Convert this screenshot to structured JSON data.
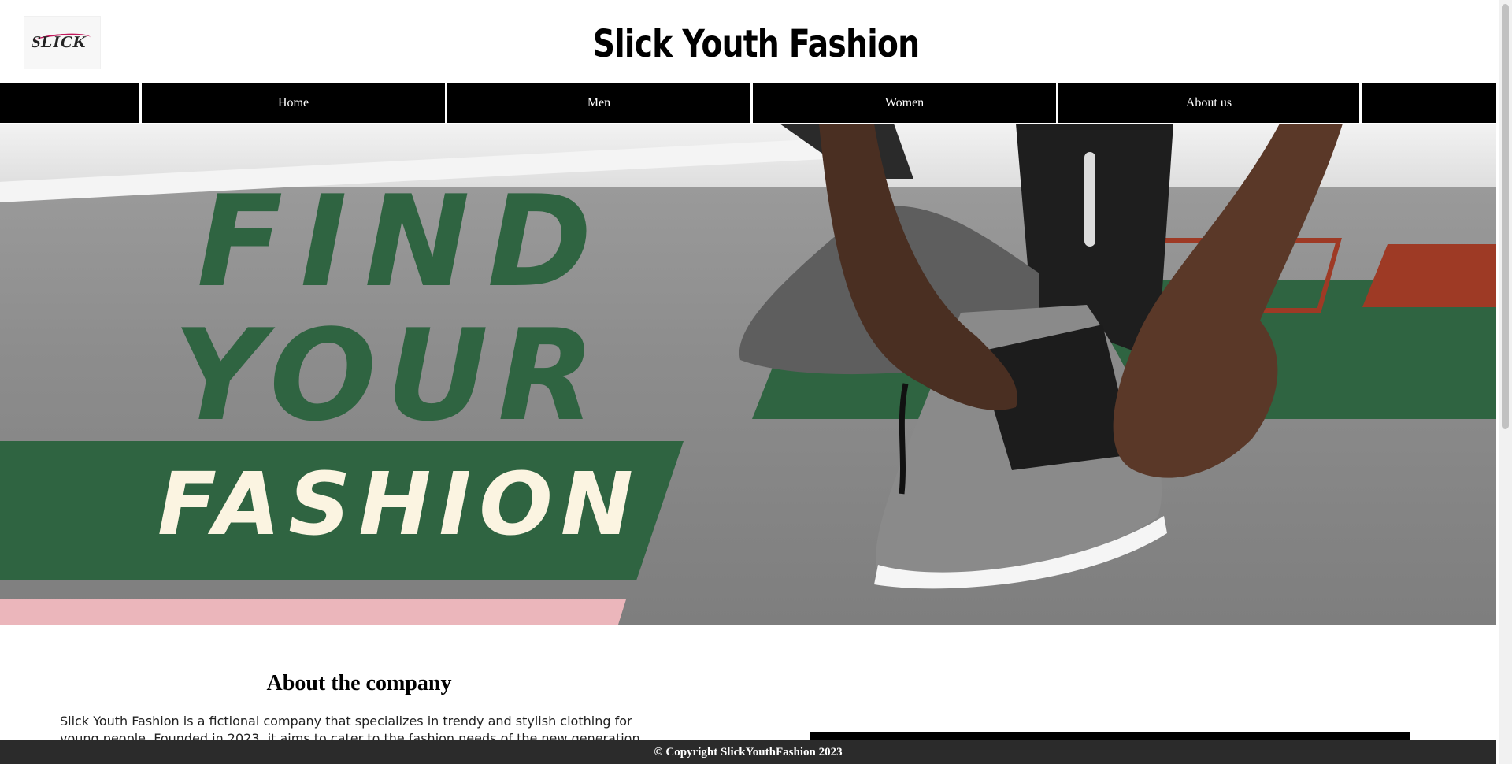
{
  "header": {
    "logo_text": "SLICK",
    "site_title": "Slick Youth Fashion"
  },
  "nav": {
    "items": [
      {
        "label": "Home"
      },
      {
        "label": "Men"
      },
      {
        "label": "Women"
      },
      {
        "label": "About us"
      }
    ]
  },
  "hero": {
    "line1": "FIND",
    "line2": "YOUR",
    "line3": "FASHION",
    "colors": {
      "green": "#2f6441",
      "cream": "#fbf4e1",
      "rust": "#9e3a25",
      "pink": "#ebb6bb"
    }
  },
  "about": {
    "title": "About the company",
    "text": "Slick Youth Fashion is a fictional company that specializes in trendy and stylish clothing for young people. Founded in 2023, it aims to cater to the fashion needs of the new generation, who value style"
  },
  "footer": {
    "copyright": "© Copyright SlickYouthFashion 2023"
  }
}
